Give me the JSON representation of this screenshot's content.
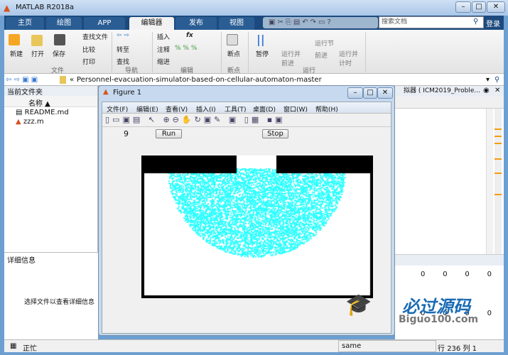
{
  "window": {
    "title": "MATLAB R2018a"
  },
  "tabs": [
    {
      "label": "主页"
    },
    {
      "label": "绘图"
    },
    {
      "label": "APP"
    },
    {
      "label": "编辑器"
    },
    {
      "label": "发布"
    },
    {
      "label": "视图"
    }
  ],
  "search": {
    "placeholder": "搜索文档"
  },
  "login": "登录",
  "ribbon": {
    "file": {
      "new": "新建",
      "open": "打开",
      "save": "保存",
      "find_files": "查找文件",
      "compare": "比较",
      "print": "打印",
      "group": "文件"
    },
    "nav": {
      "goto": "转至",
      "find": "查找",
      "group": "导航"
    },
    "edit": {
      "insert": "插入",
      "comment": "注释",
      "indent": "缩进",
      "fx": "fx",
      "group": "编辑"
    },
    "breakpoints": {
      "label": "断点",
      "group": "断点"
    },
    "run": {
      "pause": "暂停",
      "run_advance": "运行并前进",
      "run_section": "运行节",
      "advance": "前进",
      "run_time": "运行并计时",
      "group": "运行"
    }
  },
  "address": {
    "path": "Personnel-evacuation-simulator-based-on-cellular-automaton-master"
  },
  "current_folder": {
    "title": "当前文件夹",
    "column": "名称 ▲",
    "files": [
      "README.md",
      "zzz.m"
    ]
  },
  "details": {
    "title": "详细信息",
    "hint": "选择文件以查看详细信息"
  },
  "editor": {
    "title": "拟器 ( ICM2019_Proble..."
  },
  "workspace": {
    "row1": [
      "0",
      "0",
      "0",
      "0"
    ],
    "row2": [
      "0",
      "0",
      "0",
      "0"
    ]
  },
  "status": {
    "left": "正忙",
    "message": "same",
    "row_label": "行",
    "row": "236",
    "col_label": "列",
    "col": "1"
  },
  "figure": {
    "title": "Figure 1",
    "menu": [
      "文件(F)",
      "编辑(E)",
      "查看(V)",
      "插入(I)",
      "工具(T)",
      "桌面(D)",
      "窗口(W)",
      "帮助(H)"
    ],
    "counter": "9",
    "run": "Run",
    "stop": "Stop"
  },
  "watermark": {
    "cn": "必过源码",
    "en": "Biguo100.com"
  },
  "colors": {
    "tabbar": "#1c4a7e",
    "agents": "#33ffff"
  }
}
